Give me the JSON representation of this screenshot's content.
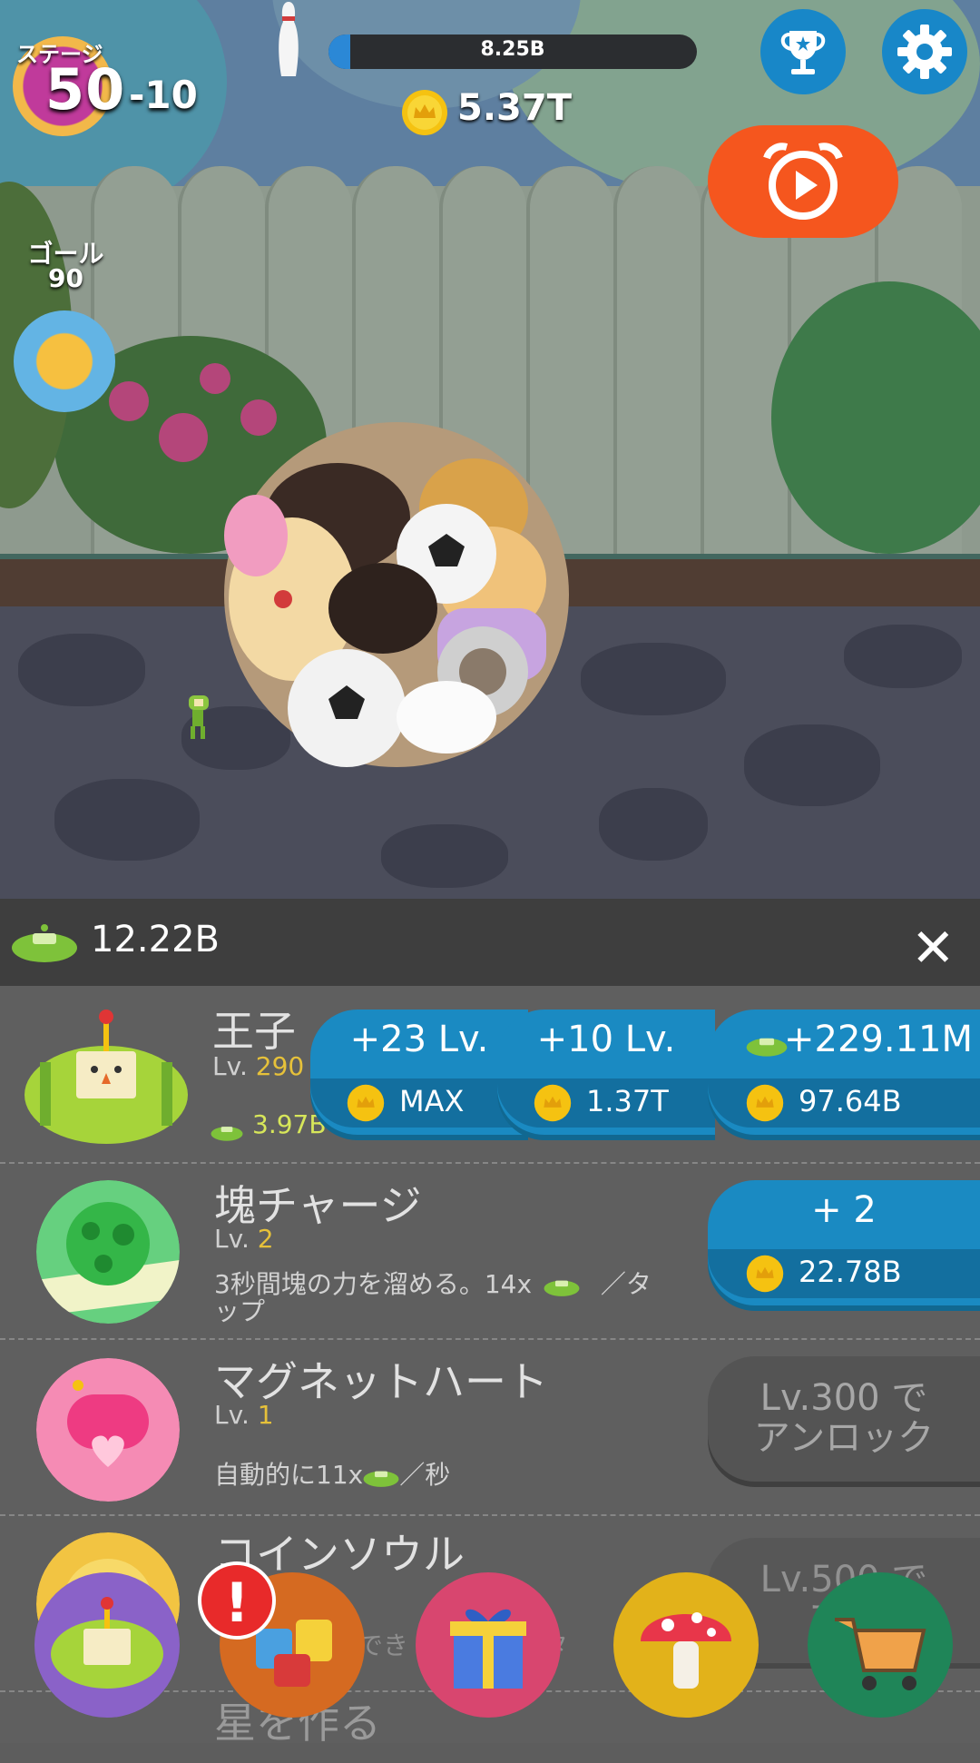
{
  "hud": {
    "stage_label": "ステージ",
    "stage_number": "50",
    "stage_sub": "-10",
    "goal_label": "ゴール",
    "goal_value": "90",
    "size_progress_text": "8.25B",
    "size_progress_fraction": 0.06,
    "coins_total": "5.37T"
  },
  "icons": {
    "pin": "bowling-pin-icon",
    "trophy": "trophy-icon",
    "settings": "gear-icon",
    "video": "alarm-play-icon",
    "coin": "coin-icon",
    "rock": "rock-currency-icon",
    "close": "close-icon"
  },
  "panel": {
    "rock_total": "12.22B",
    "close_symbol": "✕"
  },
  "upgrades": [
    {
      "title": "王子",
      "lv_prefix": "Lv. ",
      "lv_value": "290",
      "stat": "3.97B",
      "buttons": [
        {
          "top": "+23 Lv.",
          "cost": "MAX"
        },
        {
          "top": "+10 Lv.",
          "cost": "1.37T"
        },
        {
          "top": "+229.11M",
          "cost": "97.64B"
        }
      ]
    },
    {
      "title": "塊チャージ",
      "lv_prefix": "Lv. ",
      "lv_value": "2",
      "desc_a": "3秒間塊の力を溜める。14x",
      "desc_b": "／タ",
      "desc_c": "ップ",
      "button": {
        "top": "+ 2",
        "cost": "22.78B"
      }
    },
    {
      "title": "マグネットハート",
      "lv_prefix": "Lv. ",
      "lv_value": "1",
      "desc_a": "自動的に11x",
      "desc_b": "／秒",
      "lock_a": "Lv.300 で",
      "lock_b": "アンロック"
    },
    {
      "title": "コインソウル",
      "desc_partial_a": "手でき",
      "desc_partial_b": "／タ",
      "lock_a": "Lv.500 で",
      "lock_b": "アン"
    },
    {
      "title": "星を作る"
    }
  ],
  "nav": {
    "items": [
      "prince-nav-icon",
      "cousins-nav-icon",
      "gift-nav-icon",
      "mushroom-nav-icon",
      "shop-cart-nav-icon"
    ],
    "alert": "!"
  },
  "colors": {
    "blue_button": "#1a8ac2",
    "orange_video": "#f5561e",
    "gold_text": "#e6c13a",
    "alert_red": "#e82a2a"
  }
}
